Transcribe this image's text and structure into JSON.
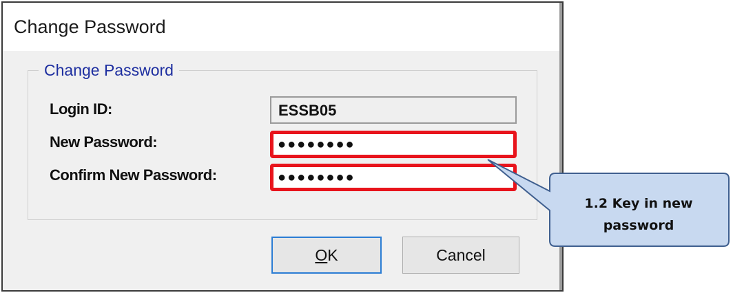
{
  "window": {
    "title": "Change Password"
  },
  "group": {
    "label": "Change Password"
  },
  "form": {
    "login_label": "Login ID:",
    "login_value": "ESSB05",
    "new_password_label": "New Password:",
    "new_password_value": "●●●●●●●●",
    "confirm_label": "Confirm New Password:",
    "confirm_value": "●●●●●●●●"
  },
  "buttons": {
    "ok_label_accel": "O",
    "ok_label_rest": "K",
    "cancel_label": "Cancel"
  },
  "callout": {
    "line1": "1.2 Key in new",
    "line2": "password"
  },
  "colors": {
    "highlight": "#e8141c",
    "callout_fill": "#c8d9f0",
    "callout_border": "#3f5f8f",
    "legend_text": "#1e2fa0"
  }
}
